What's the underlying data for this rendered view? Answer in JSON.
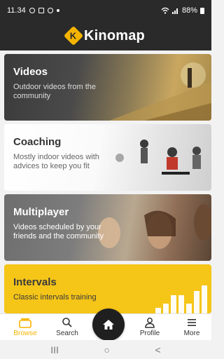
{
  "status_bar": {
    "time": "11.34",
    "battery": "88%",
    "icons": [
      "circle-notification-icon",
      "gallery-notification-icon",
      "messenger-notification-icon",
      "dot-icon",
      "wifi-icon",
      "signal-icon",
      "battery-icon"
    ]
  },
  "app": {
    "logo_letter": "K",
    "name": "Kinomap",
    "accent": "#f5b400"
  },
  "cards": [
    {
      "title": "Videos",
      "description": "Outdoor videos from the community"
    },
    {
      "title": "Coaching",
      "description": "Mostly indoor videos with advices to keep you fit"
    },
    {
      "title": "Multiplayer",
      "description": "Videos scheduled by your friends and the community"
    },
    {
      "title": "Intervals",
      "description": "Classic intervals training"
    }
  ],
  "nav": {
    "browse": "Browse",
    "search": "Search",
    "home_icon": "home-icon",
    "profile": "Profile",
    "more": "More",
    "active": "browse"
  },
  "system_nav": {
    "recents": "III",
    "home": "○",
    "back": "<"
  }
}
